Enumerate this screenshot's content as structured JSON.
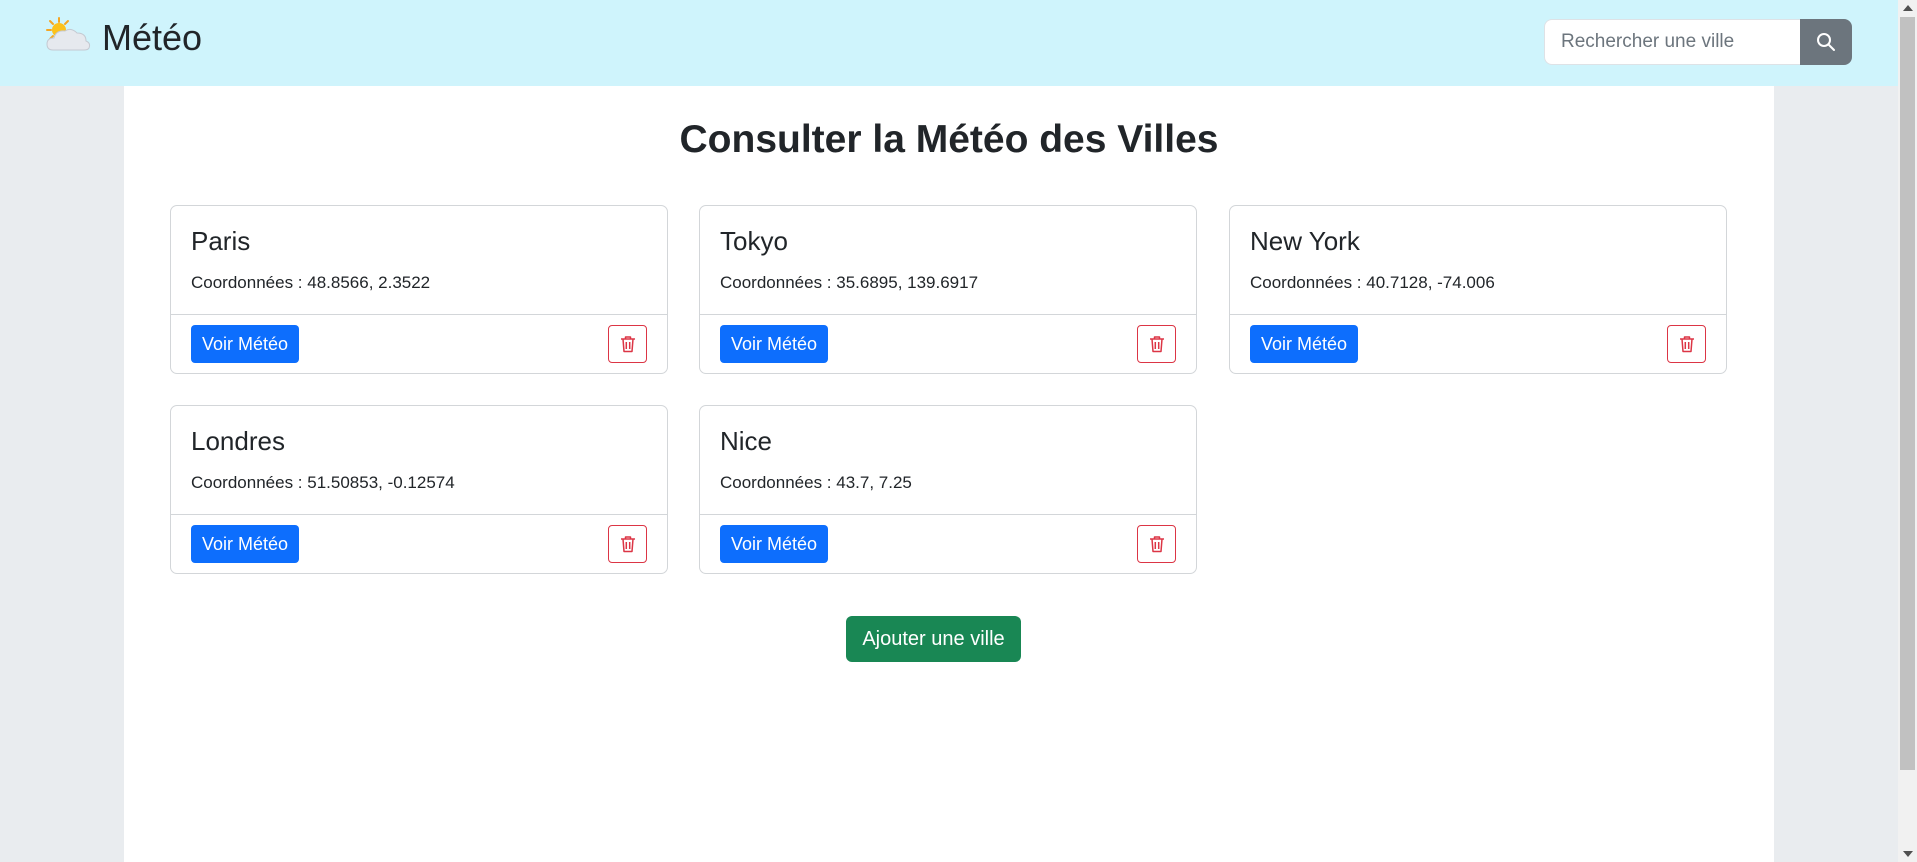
{
  "navbar": {
    "brand": "Météo",
    "brand_icon": "sun-behind-cloud-icon",
    "search_placeholder": "Rechercher une ville",
    "search_icon": "search-icon"
  },
  "main": {
    "title": "Consulter la Météo des Villes",
    "add_button": "Ajouter une ville"
  },
  "cities": [
    {
      "name": "Paris",
      "coords": "Coordonnées : 48.8566, 2.3522",
      "button": "Voir Météo"
    },
    {
      "name": "Tokyo",
      "coords": "Coordonnées : 35.6895, 139.6917",
      "button": "Voir Météo"
    },
    {
      "name": "New York",
      "coords": "Coordonnées : 40.7128, -74.006",
      "button": "Voir Météo"
    },
    {
      "name": "Londres",
      "coords": "Coordonnées : 51.50853, -0.12574",
      "button": "Voir Météo"
    },
    {
      "name": "Nice",
      "coords": "Coordonnées : 43.7, 7.25",
      "button": "Voir Météo"
    }
  ],
  "colors": {
    "navbar_bg": "#cff4fc",
    "primary": "#0d6efd",
    "danger": "#dc3545",
    "success": "#198754",
    "secondary": "#6c757d"
  }
}
